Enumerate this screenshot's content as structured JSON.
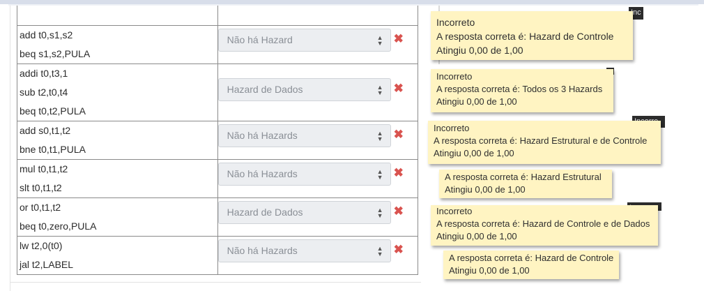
{
  "rows": [
    {
      "lines": [],
      "answer": "",
      "mark": ""
    },
    {
      "lines": [
        "add t0,s1,s2",
        "beq s1,s2,PULA"
      ],
      "answer": "Não há Hazard",
      "mark": "✖"
    },
    {
      "lines": [
        "addi t0,t3,1",
        "sub t2,t0,t4",
        "beq t0,t2,PULA"
      ],
      "answer": "Hazard de Dados",
      "mark": "✖"
    },
    {
      "lines": [
        "add s0,t1,t2",
        "bne t0,t1,PULA"
      ],
      "answer": "Não há Hazards",
      "mark": "✖"
    },
    {
      "lines": [
        "mul t0,t1,t2",
        "slt t0,t1,t2"
      ],
      "answer": "Não há Hazards",
      "mark": "✖"
    },
    {
      "lines": [
        "or t0,t1,t2",
        "beq t0,zero,PULA"
      ],
      "answer": "Hazard de Dados",
      "mark": "✖"
    },
    {
      "lines": [
        "lw t2,0(t0)",
        "jal t2,LABEL"
      ],
      "answer": "Não há Hazards",
      "mark": "✖"
    }
  ],
  "feedback": [
    {
      "status": "Incorreto",
      "correct": "A resposta correta é: Hazard de Controle",
      "score": "Atingiu 0,00 de 1,00"
    },
    {
      "status": "Incorreto",
      "correct": "A resposta correta é: Todos os 3 Hazards",
      "score": "Atingiu 0,00 de 1,00"
    },
    {
      "status": "Incorreto",
      "correct": "A resposta correta é: Hazard Estrutural e de Controle",
      "score": "Atingiu 0,00 de 1,00"
    },
    {
      "status": "",
      "correct": "A resposta correta é: Hazard Estrutural",
      "score": "Atingiu 0,00 de 1,00"
    },
    {
      "status": "Incorreto",
      "correct": "A resposta correta é: Hazard de Controle e de Dados",
      "score": "Atingiu 0,00 de 1,00"
    },
    {
      "status": "",
      "correct": "A resposta correta é: Hazard de Controle",
      "score": "Atingiu 0,00 de 1,00"
    }
  ],
  "overlay_tabs": [
    "Inc",
    "Incorre",
    "Incorre"
  ],
  "colors": {
    "tooltip_bg": "#fff4c2",
    "error_mark": "#d9534f",
    "select_bg": "#eceef1"
  }
}
